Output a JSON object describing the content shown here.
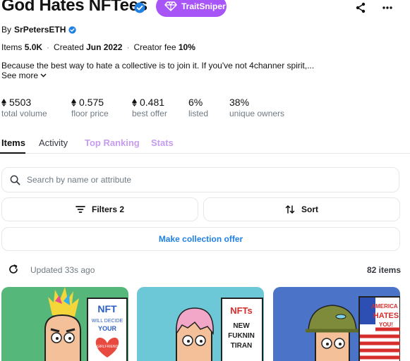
{
  "collection": {
    "title": "God Hates NFTees",
    "trait_button": "TraitSniper",
    "by_prefix": "By",
    "creator": "SrPetersETH"
  },
  "meta": {
    "items_label": "Items",
    "items_value": "5.0K",
    "created_label": "Created",
    "created_value": "Jun 2022",
    "fee_label": "Creator fee",
    "fee_value": "10%"
  },
  "description": {
    "text": "Because the best way to hate a collective is to join it. If you've not 4channer spirit,...",
    "see_more": "See more"
  },
  "stats": [
    {
      "value": "5503",
      "label": "total volume",
      "eth": true
    },
    {
      "value": "0.575",
      "label": "floor price",
      "eth": true
    },
    {
      "value": "0.481",
      "label": "best offer",
      "eth": true
    },
    {
      "value": "6%",
      "label": "listed",
      "eth": false
    },
    {
      "value": "38%",
      "label": "unique owners",
      "eth": false
    }
  ],
  "tabs": [
    {
      "label": "Items"
    },
    {
      "label": "Activity"
    },
    {
      "label": "Top Ranking"
    },
    {
      "label": "Stats"
    }
  ],
  "search": {
    "placeholder": "Search by name or attribute"
  },
  "controls": {
    "filters": "Filters 2",
    "sort": "Sort",
    "make_offer": "Make collection offer"
  },
  "status": {
    "updated": "Updated 33s ago",
    "count": "82 items"
  },
  "cards": [
    {
      "sign_lines": [
        "NFT",
        "WILL DECIDE",
        "YOUR",
        "GIRLFRIEND"
      ]
    },
    {
      "sign_lines": [
        "NFTs",
        "NEW",
        "FUKNIN",
        "TIRAN"
      ]
    },
    {
      "sign_lines": [
        "AMERICA",
        "HATES",
        "YOU!"
      ]
    }
  ],
  "colors": {
    "accent": "#2081e2",
    "trait_purple": "#a855f7",
    "tab_purple": "#c59cf0"
  }
}
